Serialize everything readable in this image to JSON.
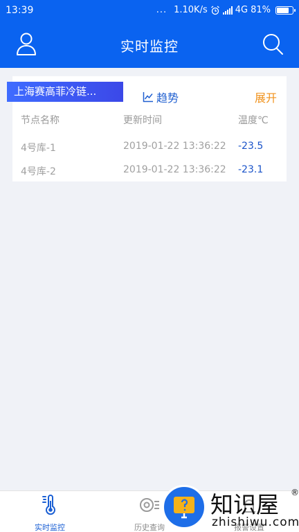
{
  "status_bar": {
    "time": "13:39",
    "dots": "...",
    "net_speed": "1.10K/s",
    "network": "4G",
    "battery": "81%",
    "battery_level": 0.81
  },
  "app_bar": {
    "title": "实时监控",
    "user_icon": "user-icon",
    "search_icon": "search-icon"
  },
  "card": {
    "company": "上海赛高菲冷链...",
    "trend_label": "趋势",
    "expand_label": "展开",
    "columns": [
      "节点名称",
      "更新时间",
      "温度℃"
    ],
    "rows": [
      {
        "name": "4号库-1",
        "time": "2019-01-22 13:36:22",
        "temp": "-23.5"
      },
      {
        "name": "4号库-2",
        "time": "2019-01-22 13:36:22",
        "temp": "-23.1"
      }
    ]
  },
  "tabs": [
    {
      "label": "实时监控",
      "icon": "thermometer-icon",
      "active": true
    },
    {
      "label": "历史查询",
      "icon": "history-icon",
      "active": false
    },
    {
      "label": "",
      "icon": "",
      "active": false
    },
    {
      "label": "报警设置",
      "icon": "alarm-icon",
      "active": false
    }
  ],
  "watermark": {
    "text": "知识屋",
    "sub": "zhishiwu.com",
    "reg": "®"
  },
  "colors": {
    "primary": "#0a63f0",
    "accent_orange": "#f0921c",
    "temp_blue": "#1a53c9"
  }
}
